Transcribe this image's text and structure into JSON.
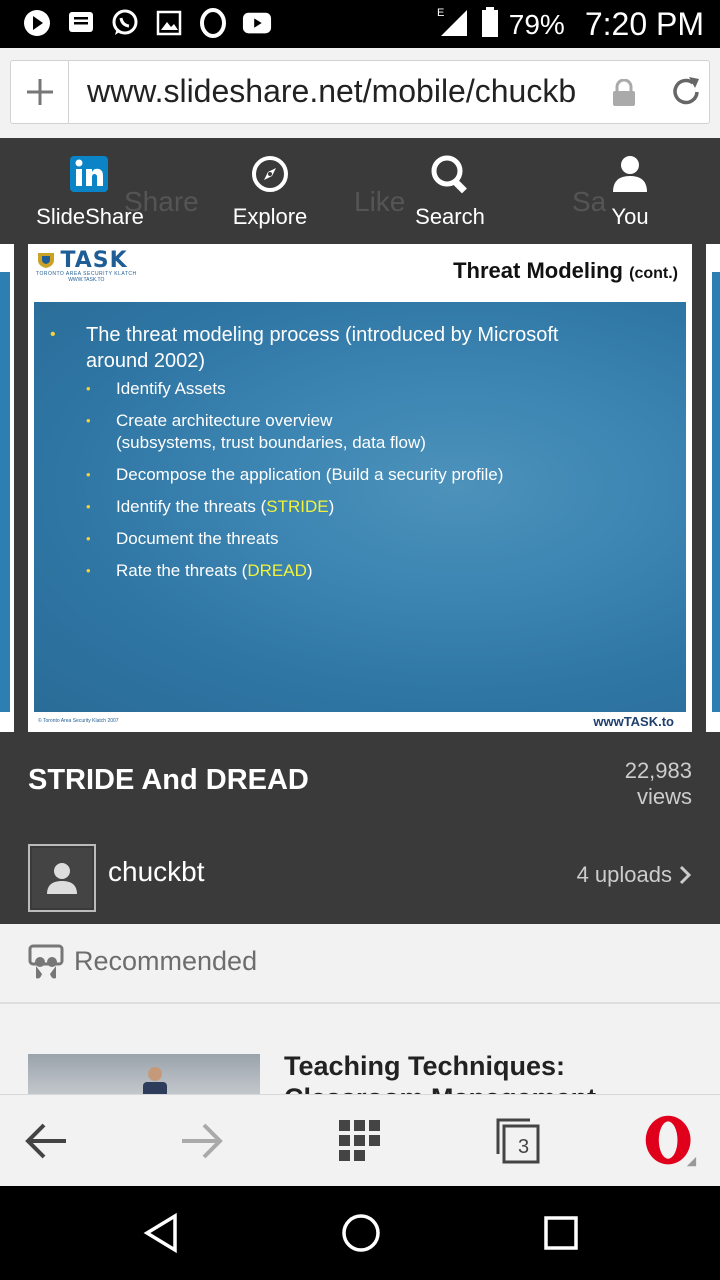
{
  "status_bar": {
    "battery_percent": "79%",
    "time": "7:20 PM",
    "network": "E"
  },
  "browser": {
    "url": "www.slideshare.net/mobile/chuckb",
    "tab_count": "3"
  },
  "nav": {
    "items": [
      {
        "label": "SlideShare",
        "icon": "linkedin-icon"
      },
      {
        "label": "Explore",
        "icon": "compass-icon"
      },
      {
        "label": "Search",
        "icon": "search-icon"
      },
      {
        "label": "You",
        "icon": "person-icon"
      }
    ],
    "ghost_labels": [
      "Share",
      "Like",
      "Sa"
    ]
  },
  "slide": {
    "logo_text": "TASK",
    "logo_sub": "TORONTO AREA SECURITY KLATCH",
    "logo_url": "WWW.TASK.TO",
    "title": "Threat Modeling",
    "title_suffix": "(cont.)",
    "main_bullet_line1": "The threat modeling process (introduced by Microsoft",
    "main_bullet_line2": "around 2002)",
    "sub_bullets": {
      "b1": "Identify Assets",
      "b2_line1": "Create architecture overview",
      "b2_line2": "(subsystems, trust boundaries, data flow)",
      "b3": "Decompose the application (Build a security profile)",
      "b4_pre": "Identify the threats (",
      "b4_hl": "STRIDE",
      "b4_post": ")",
      "b5": "Document the threats",
      "b6_pre": "Rate the threats (",
      "b6_hl": "DREAD",
      "b6_post": ")"
    },
    "footer_copyright": "© Toronto Area Security Klatch 2007",
    "footer_url": "wwwTASK.to"
  },
  "presentation": {
    "title": "STRIDE And DREAD",
    "views_count": "22,983",
    "views_label": "views",
    "author": "chuckbt",
    "uploads": "4 uploads"
  },
  "recommended": {
    "label": "Recommended",
    "items": [
      {
        "title": "Teaching Techniques: Classroom Management"
      }
    ]
  },
  "colors": {
    "nav_bg": "#3a3a3a",
    "slide_blue": "#2f76a4",
    "highlight_yellow": "#f2f23a",
    "opera_red": "#e0001b"
  }
}
